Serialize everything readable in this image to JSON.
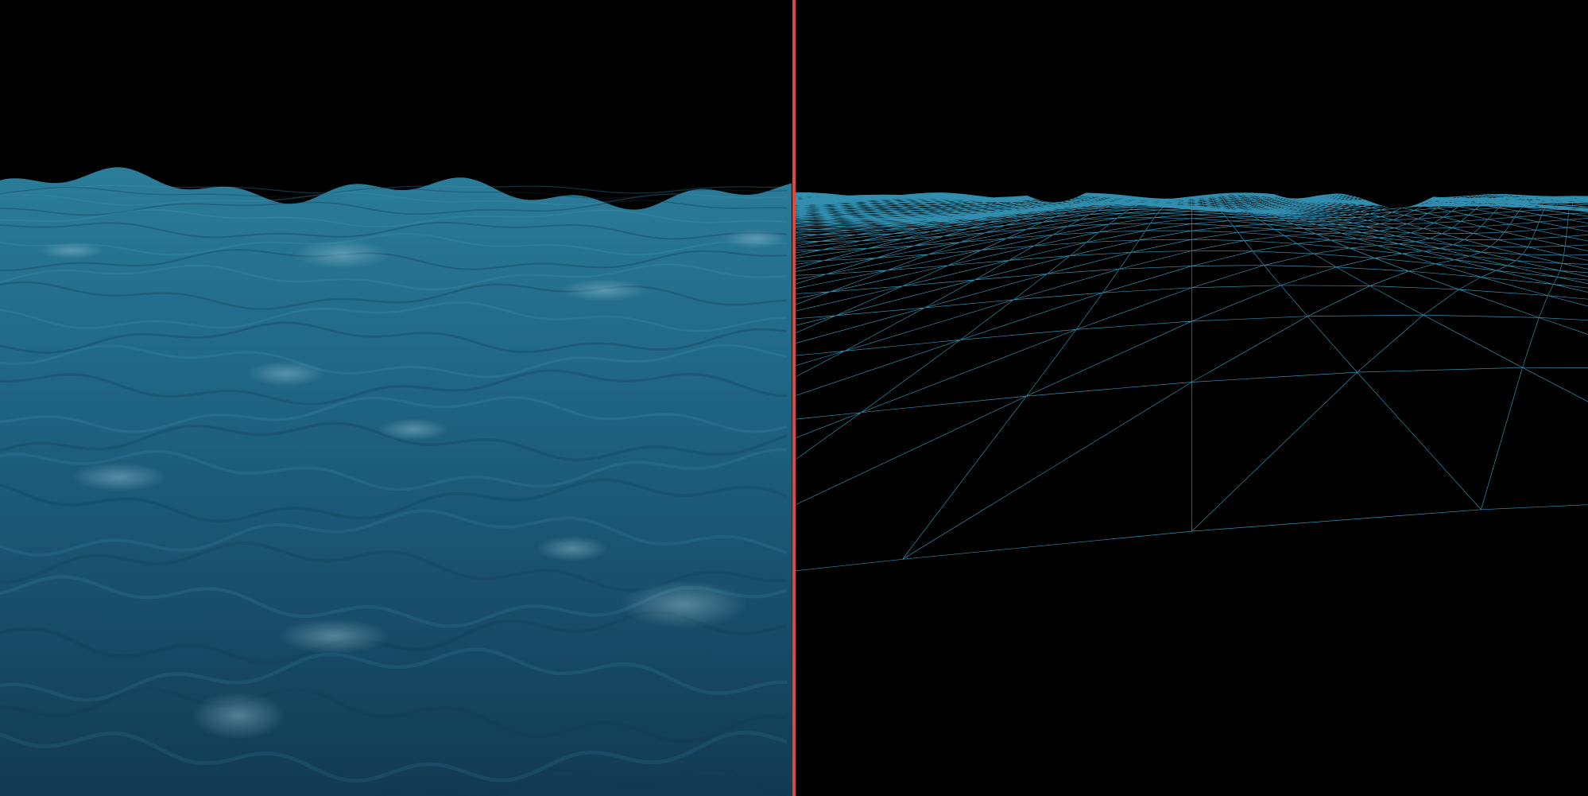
{
  "scene": {
    "background_color": "#000000",
    "left_view": {
      "mode": "shaded",
      "water_color_far": "#2b7d9a",
      "water_color_near": "#123a52",
      "highlight_color": "#9fc7d6"
    },
    "right_view": {
      "mode": "wireframe",
      "wire_color": "#3aa7cc"
    },
    "divider_color": "#e0483f"
  }
}
